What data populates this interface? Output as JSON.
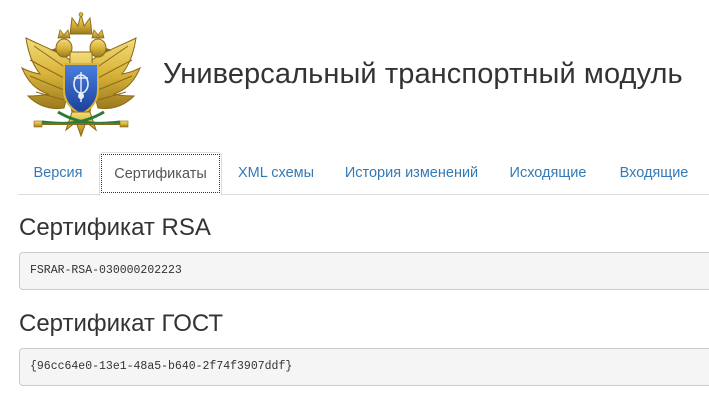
{
  "header": {
    "logo_icon": "double-headed-eagle-emblem-icon",
    "title": "Универсальный транспортный модуль"
  },
  "tabs": [
    {
      "label": "Версия",
      "active": false
    },
    {
      "label": "Сертификаты",
      "active": true
    },
    {
      "label": "XML схемы",
      "active": false
    },
    {
      "label": "История изменений",
      "active": false
    },
    {
      "label": "Исходящие",
      "active": false
    },
    {
      "label": "Входящие",
      "active": false
    }
  ],
  "certificates": {
    "rsa": {
      "heading": "Сертификат RSA",
      "value": "FSRAR-RSA-030000202223"
    },
    "gost": {
      "heading": "Сертификат ГОСТ",
      "value": "{96cc64e0-13e1-48a5-b640-2f74f3907ddf}"
    }
  },
  "colors": {
    "link": "#337ab7",
    "active_tab_text": "#555555",
    "code_background": "#f5f5f5",
    "border": "#dddddd",
    "emblem_gold": "#d9b43a",
    "emblem_blue": "#1e4fb4"
  }
}
